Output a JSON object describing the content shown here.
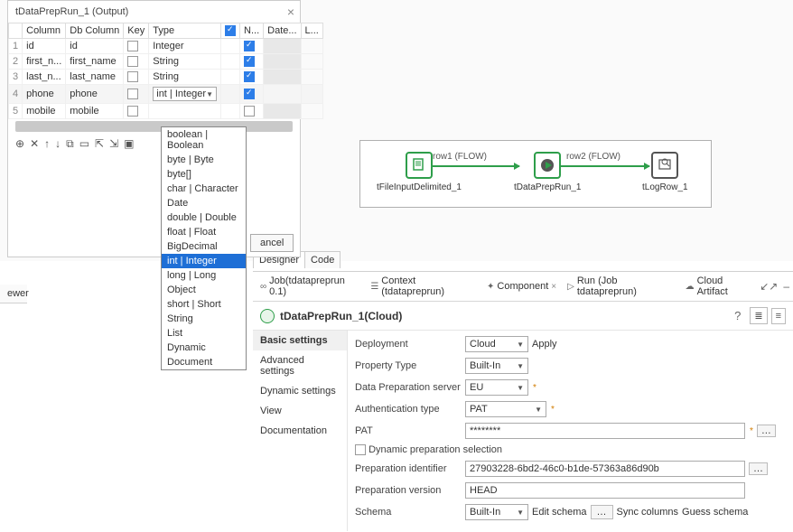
{
  "dialog": {
    "title": "tDataPrepRun_1 (Output)",
    "columns": [
      "",
      "Column",
      "Db Column",
      "Key",
      "Type",
      "",
      "N...",
      "Date...",
      "L..."
    ],
    "rows": [
      {
        "idx": "1",
        "col": "id",
        "db": "id",
        "key": false,
        "type": "Integer",
        "nullable": true
      },
      {
        "idx": "2",
        "col": "first_n...",
        "db": "first_name",
        "key": false,
        "type": "String",
        "nullable": true
      },
      {
        "idx": "3",
        "col": "last_n...",
        "db": "last_name",
        "key": false,
        "type": "String",
        "nullable": true
      },
      {
        "idx": "4",
        "col": "phone",
        "db": "phone",
        "key": false,
        "type": "int | Integer",
        "nullable": true,
        "selected": true,
        "editing": true
      },
      {
        "idx": "5",
        "col": "mobile",
        "db": "mobile",
        "key": false,
        "type": "",
        "nullable": false
      }
    ],
    "cancel": "ancel"
  },
  "type_options": [
    "boolean | Boolean",
    "byte | Byte",
    "byte[]",
    "char | Character",
    "Date",
    "double | Double",
    "float | Float",
    "BigDecimal",
    "int | Integer",
    "long | Long",
    "Object",
    "short | Short",
    "String",
    "List",
    "Dynamic",
    "Document"
  ],
  "type_selected_index": 8,
  "diagram": {
    "nodes": [
      "tFileInputDelimited_1",
      "tDataPrepRun_1",
      "tLogRow_1"
    ],
    "flows": [
      "row1 (FLOW)",
      "row2 (FLOW)"
    ]
  },
  "viewer_tab": "ewer",
  "design_tabs": {
    "designer": "Designer",
    "code": "Code"
  },
  "lp_tabs": {
    "job": "Job(tdatapreprun 0.1)",
    "context": "Context (tdatapreprun)",
    "component": "Component",
    "run": "Run (Job tdatapreprun)",
    "cloud": "Cloud Artifact"
  },
  "component": {
    "title": "tDataPrepRun_1(Cloud)",
    "nav": [
      "Basic settings",
      "Advanced settings",
      "Dynamic settings",
      "View",
      "Documentation"
    ],
    "deployment_lbl": "Deployment",
    "deployment": "Cloud",
    "apply": "Apply",
    "ptype_lbl": "Property Type",
    "ptype": "Built-In",
    "dps_lbl": "Data Preparation server",
    "dps": "EU",
    "auth_lbl": "Authentication type",
    "auth": "PAT",
    "pat_lbl": "PAT",
    "pat": "********",
    "dyn_sel": "Dynamic preparation selection",
    "prep_id_lbl": "Preparation identifier",
    "prep_id": "27903228-6bd2-46c0-b1de-57363a86d90b",
    "prep_ver_lbl": "Preparation version",
    "prep_ver": "HEAD",
    "schema_lbl": "Schema",
    "schema": "Built-In",
    "edit_schema": "Edit schema",
    "sync": "Sync columns",
    "guess": "Guess schema"
  }
}
